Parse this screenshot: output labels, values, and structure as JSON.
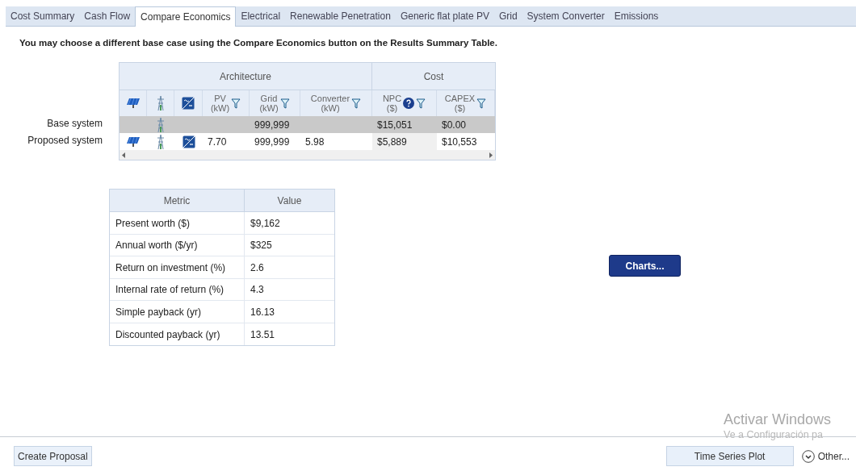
{
  "tabs": [
    {
      "label": "Cost Summary",
      "selected": false
    },
    {
      "label": "Cash Flow",
      "selected": false
    },
    {
      "label": "Compare Economics",
      "selected": true
    },
    {
      "label": "Electrical",
      "selected": false
    },
    {
      "label": "Renewable Penetration",
      "selected": false
    },
    {
      "label": "Generic flat plate PV",
      "selected": false
    },
    {
      "label": "Grid",
      "selected": false
    },
    {
      "label": "System Converter",
      "selected": false
    },
    {
      "label": "Emissions",
      "selected": false
    }
  ],
  "note": "You may choose a different base case using the Compare Economics button on the Results Summary Table.",
  "systems_table": {
    "groups": [
      "Architecture",
      "Cost"
    ],
    "columns": [
      {
        "kind": "icon"
      },
      {
        "kind": "icon"
      },
      {
        "kind": "icon"
      },
      {
        "kind": "value",
        "label": "PV",
        "unit": "(kW)",
        "help": false
      },
      {
        "kind": "value",
        "label": "Grid",
        "unit": "(kW)",
        "help": false
      },
      {
        "kind": "value",
        "label": "Converter",
        "unit": "(kW)",
        "help": false
      },
      {
        "kind": "value",
        "label": "NPC",
        "unit": "($)",
        "help": true
      },
      {
        "kind": "value",
        "label": "CAPEX",
        "unit": "($)",
        "help": false
      }
    ],
    "rows": [
      {
        "label": "Base system",
        "selected": true,
        "pv": false,
        "grid": true,
        "converter": false,
        "cells": [
          "",
          "",
          "",
          "",
          "999,999",
          "",
          "$15,051",
          "$0.00"
        ]
      },
      {
        "label": "Proposed system",
        "selected": false,
        "pv": true,
        "grid": true,
        "converter": true,
        "cells": [
          "",
          "",
          "",
          "7.70",
          "999,999",
          "5.98",
          "$5,889",
          "$10,553"
        ]
      }
    ]
  },
  "metrics_table": {
    "columns": [
      "Metric",
      "Value"
    ],
    "rows": [
      [
        "Present worth ($)",
        "$9,162"
      ],
      [
        "Annual worth ($/yr)",
        "$325"
      ],
      [
        "Return on investment (%)",
        "2.6"
      ],
      [
        "Internal rate of return (%)",
        "4.3"
      ],
      [
        "Simple payback (yr)",
        "16.13"
      ],
      [
        "Discounted payback (yr)",
        "13.51"
      ]
    ]
  },
  "charts_button": "Charts...",
  "footer": {
    "create_proposal": "Create Proposal",
    "time_series_plot": "Time Series Plot",
    "other": "Other..."
  },
  "os_overlay": {
    "title": "Activar Windows",
    "subtitle": "Ve a Configuración pa"
  }
}
